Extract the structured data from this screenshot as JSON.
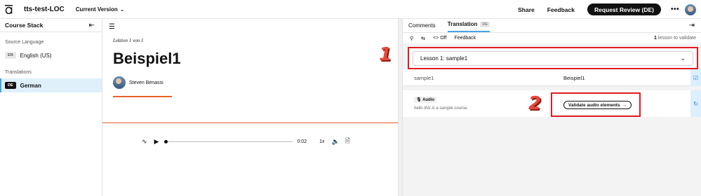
{
  "header": {
    "project_name": "tts-test-LOC",
    "version_label": "Current Version",
    "share_label": "Share",
    "feedback_label": "Feedback",
    "review_button_label": "Request Review (DE)",
    "more_label": "•••"
  },
  "sidebar": {
    "title": "Course Stack",
    "source_section": "Source Language",
    "source_badge": "EN",
    "source_language": "English (US)",
    "translations_section": "Translations",
    "translation_badge": "DE",
    "translation_language": "German"
  },
  "preview": {
    "lesson_label": "Lektion 1 von 1",
    "title": "Beispiel1",
    "author": "Steven Benassi",
    "audio_time": "0:02",
    "audio_speed": "1x"
  },
  "panel": {
    "tabs": [
      {
        "label": "Comments"
      },
      {
        "label": "Translation",
        "badge": "DE"
      }
    ],
    "toolbar": {
      "code_label": "Off",
      "feedback_label": "Feedback",
      "lesson_count": "1",
      "lesson_count_suffix": "lesson to validate"
    },
    "lesson_select": "Lesson 1: sample1",
    "row1": {
      "source": "sample1",
      "target": "Beispiel1"
    },
    "row2": {
      "chip": "Audio",
      "text": "hello this is a sample course.",
      "button_label": "Validate audio elements"
    }
  },
  "annotations": {
    "one": "1",
    "two": "2"
  },
  "colors": {
    "accent_blue": "#4aa3df",
    "highlight_red": "#e01b24",
    "progress_orange": "#e8622a"
  }
}
